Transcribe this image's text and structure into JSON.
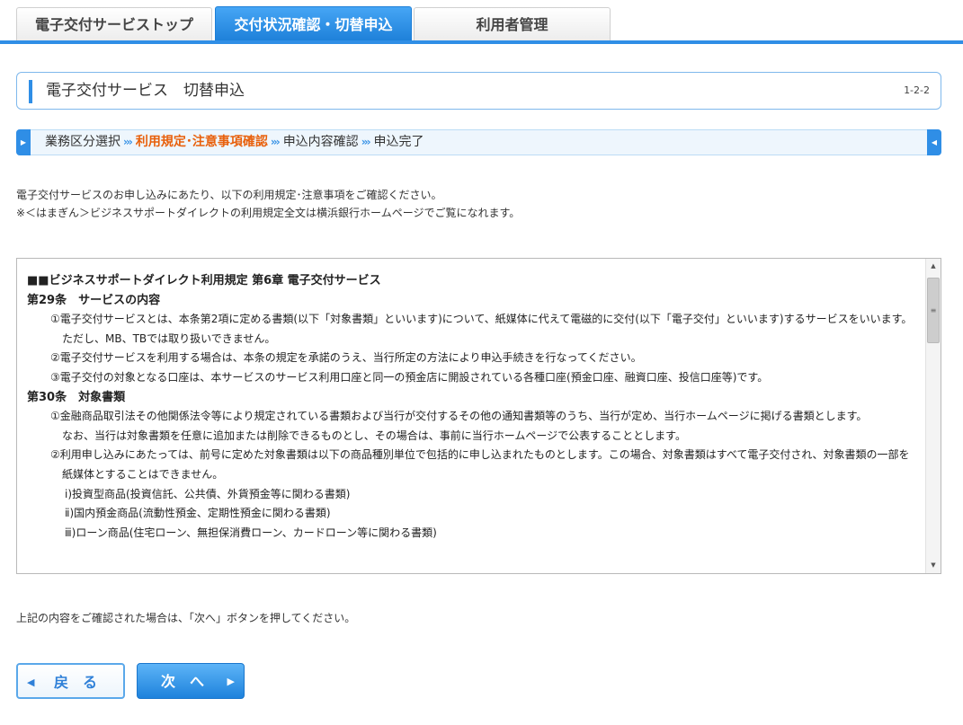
{
  "tabs": [
    {
      "label": "電子交付サービストップ"
    },
    {
      "label": "交付状況確認・切替申込"
    },
    {
      "label": "利用者管理"
    }
  ],
  "colors": {
    "accent": "#2f8ee6",
    "current_step": "#e8600c"
  },
  "header": {
    "title": "電子交付サービス　切替申込",
    "page_no": "1-2-2"
  },
  "steps": {
    "items": [
      "業務区分選択",
      "利用規定･注意事項確認",
      "申込内容確認",
      "申込完了"
    ],
    "current_index": 1,
    "separator": "›››"
  },
  "intro": {
    "line1": "電子交付サービスのお申し込みにあたり、以下の利用規定･注意事項をご確認ください。",
    "line2": "※＜はまぎん＞ビジネスサポートダイレクトの利用規定全文は横浜銀行ホームページでご覧になれます。"
  },
  "terms": {
    "heading": "■■ビジネスサポートダイレクト利用規定 第6章 電子交付サービス",
    "art29_title": "第29条　サービスの内容",
    "art29_p1": "①電子交付サービスとは、本条第2項に定める書類(以下「対象書類」といいます)について、紙媒体に代えて電磁的に交付(以下「電子交付」といいます)するサービスをいいます。",
    "art29_p1b": "ただし、MB、TBでは取り扱いできません。",
    "art29_p2": "②電子交付サービスを利用する場合は、本条の規定を承諾のうえ、当行所定の方法により申込手続きを行なってください。",
    "art29_p3": "③電子交付の対象となる口座は、本サービスのサービス利用口座と同一の預金店に開設されている各種口座(預金口座、融資口座、投信口座等)です。",
    "art30_title": "第30条　対象書類",
    "art30_p1": "①金融商品取引法その他関係法令等により規定されている書類および当行が交付するその他の通知書類等のうち、当行が定め、当行ホームページに掲げる書類とします。",
    "art30_p1b": "なお、当行は対象書類を任意に追加または削除できるものとし、その場合は、事前に当行ホームページで公表することとします。",
    "art30_p2": "②利用申し込みにあたっては、前号に定めた対象書類は以下の商品種別単位で包括的に申し込まれたものとします。この場合、対象書類はすべて電子交付され、対象書類の一部を紙媒体とすることはできません。",
    "art30_i": "ⅰ)投資型商品(投資信託、公共債、外貨預金等に関わる書類)",
    "art30_ii": "ⅱ)国内預金商品(流動性預金、定期性預金に関わる書類)",
    "art30_iii": "ⅲ)ローン商品(住宅ローン、無担保消費ローン、カードローン等に関わる書類)"
  },
  "note": "上記の内容をご確認された場合は、「次へ」ボタンを押してください。",
  "buttons": {
    "back": "戻る",
    "next": "次へ"
  }
}
